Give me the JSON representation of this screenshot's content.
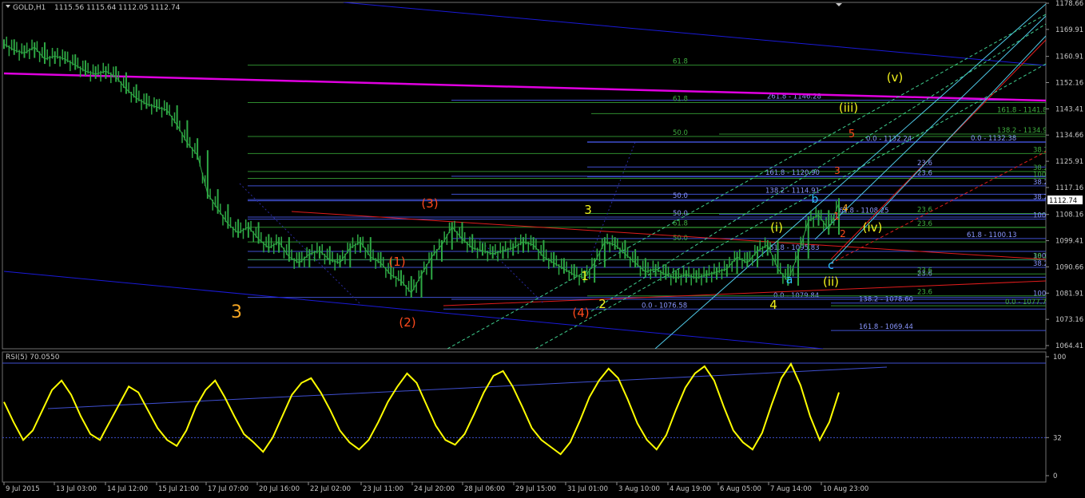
{
  "header": {
    "symbol": "GOLD,H1",
    "ohlc": "1115.56 1115.64 1112.05 1112.74",
    "current_price": "1112.74",
    "rsi_label": "RSI(5) 70.0550"
  },
  "colors": {
    "background": "#000000",
    "candles": "#2ea844",
    "rsi_line": "#ffff00",
    "fib_green": "#2e8b2e",
    "fib_blue": "#3f4fd0",
    "channel_blue": "#1a1ad8",
    "magenta_line": "#e000e0",
    "red_line": "#e01c1c",
    "cyan_line": "#4fc9e8",
    "wave_orange": "#f5a623",
    "wave_red": "#ff4a1c",
    "wave_yellow": "#f2f21c",
    "wave_cyan": "#2ec5ff"
  },
  "chart_data": [
    {
      "type": "line",
      "name": "price",
      "ylim": [
        1064.41,
        1178.66
      ],
      "y_ticks": [
        "1178.66",
        "1169.91",
        "1160.91",
        "1152.16",
        "1143.41",
        "1134.66",
        "1125.91",
        "1117.16",
        "1108.16",
        "1099.41",
        "1090.66",
        "1081.91",
        "1073.16",
        "1064.41"
      ],
      "x_ticks": [
        "9 Jul 2015",
        "13 Jul 03:00",
        "14 Jul 12:00",
        "15 Jul 21:00",
        "17 Jul 07:00",
        "20 Jul 16:00",
        "22 Jul 02:00",
        "23 Jul 11:00",
        "24 Jul 20:00",
        "28 Jul 06:00",
        "29 Jul 15:00",
        "31 Jul 01:00",
        "3 Aug 10:00",
        "4 Aug 19:00",
        "6 Aug 05:00",
        "7 Aug 14:00",
        "10 Aug 23:00"
      ],
      "approx_closes": [
        1165,
        1163,
        1162,
        1164,
        1160,
        1161,
        1160,
        1158,
        1156,
        1155,
        1156,
        1154,
        1150,
        1147,
        1145,
        1144,
        1143,
        1138,
        1132,
        1128,
        1115,
        1110,
        1105,
        1102,
        1104,
        1100,
        1097,
        1099,
        1094,
        1092,
        1095,
        1096,
        1093,
        1092,
        1097,
        1099,
        1094,
        1092,
        1088,
        1086,
        1082,
        1088,
        1094,
        1098,
        1104,
        1100,
        1097,
        1096,
        1095,
        1096,
        1097,
        1099,
        1098,
        1094,
        1092,
        1090,
        1088,
        1087,
        1092,
        1099,
        1098,
        1095,
        1092,
        1089,
        1090,
        1088,
        1087,
        1088,
        1087,
        1088,
        1089,
        1090,
        1094,
        1092,
        1096,
        1098,
        1090,
        1086,
        1095,
        1106,
        1108,
        1103,
        1112
      ],
      "wave_labels": [
        {
          "text": "3",
          "price": 1078.5
        },
        {
          "text": "(1)",
          "price": 1091.5
        },
        {
          "text": "(2)",
          "price": 1074.5
        },
        {
          "text": "(3)",
          "price": 1108.5
        },
        {
          "text": "(4)",
          "price": 1076.5
        },
        {
          "text": "1",
          "price": 1088.5
        },
        {
          "text": "2",
          "price": 1079.5
        },
        {
          "text": "3",
          "price": 1107.5
        },
        {
          "text": "4",
          "price": 1080.5
        },
        {
          "text": "(i)",
          "price": 1101.5
        },
        {
          "text": "(ii)",
          "price": 1087.5
        },
        {
          "text": "a",
          "price": 1088.5
        },
        {
          "text": "b",
          "price": 1110.5
        },
        {
          "text": "c",
          "price": 1093.5
        },
        {
          "text": "(iii)",
          "price": 1141.5
        },
        {
          "text": "(iv)",
          "price": 1102.5
        },
        {
          "text": "(v)",
          "price": 1153.5
        },
        {
          "text": "1",
          "price": 1107.5
        },
        {
          "text": "2",
          "price": 1095.5
        },
        {
          "text": "3",
          "price": 1120.5
        },
        {
          "text": "4",
          "price": 1108.5
        },
        {
          "text": "5",
          "price": 1134.5
        }
      ],
      "fib_levels": [
        {
          "label": "261.8 - 1146.28",
          "price": 1146.28,
          "color": "blue"
        },
        {
          "label": "61.8",
          "price": 1145.5,
          "color": "green"
        },
        {
          "label": "161.8 - 1141.82",
          "price": 1141.82,
          "color": "green"
        },
        {
          "label": "50.0",
          "price": 1134.2,
          "color": "green"
        },
        {
          "label": "0.0 - 1132.24",
          "price": 1132.24,
          "color": "blue"
        },
        {
          "label": "0.0 - 1132.38",
          "price": 1132.38,
          "color": "blue"
        },
        {
          "label": "138.2 - 1134.99",
          "price": 1134.99,
          "color": "green"
        },
        {
          "label": "38.2",
          "price": 1128.5,
          "color": "green"
        },
        {
          "label": "23.6",
          "price": 1124.0,
          "color": "blue"
        },
        {
          "label": "38.2",
          "price": 1122.5,
          "color": "green"
        },
        {
          "label": "161.8 - 1120.90",
          "price": 1120.9,
          "color": "blue"
        },
        {
          "label": "23.6",
          "price": 1120.7,
          "color": "blue"
        },
        {
          "label": "100.0",
          "price": 1120.2,
          "color": "green"
        },
        {
          "label": "38.2",
          "price": 1117.7,
          "color": "blue"
        },
        {
          "label": "138.2 - 1114.91",
          "price": 1114.91,
          "color": "blue"
        },
        {
          "label": "50.0",
          "price": 1113.1,
          "color": "blue"
        },
        {
          "label": "38.2",
          "price": 1112.7,
          "color": "blue"
        },
        {
          "label": "61.8 - 1108.25",
          "price": 1108.25,
          "color": "blue"
        },
        {
          "label": "23.6",
          "price": 1108.5,
          "color": "green"
        },
        {
          "label": "50.0",
          "price": 1107.3,
          "color": "blue"
        },
        {
          "label": "100.0",
          "price": 1106.6,
          "color": "blue"
        },
        {
          "label": "23.6",
          "price": 1103.8,
          "color": "green"
        },
        {
          "label": "61.8",
          "price": 1103.9,
          "color": "green"
        },
        {
          "label": "61.8 - 1100.13",
          "price": 1100.13,
          "color": "blue"
        },
        {
          "label": "50.0",
          "price": 1099.0,
          "color": "green"
        },
        {
          "label": "61.8 - 1095.83",
          "price": 1095.83,
          "color": "blue"
        },
        {
          "label": "100.0",
          "price": 1093.0,
          "color": "blue"
        },
        {
          "label": "38.2",
          "price": 1093.1,
          "color": "green"
        },
        {
          "label": "38.2",
          "price": 1090.5,
          "color": "blue"
        },
        {
          "label": "23.6",
          "price": 1087.2,
          "color": "blue"
        },
        {
          "label": "23.6",
          "price": 1088.3,
          "color": "green"
        },
        {
          "label": "0.0 - 1079.84",
          "price": 1079.84,
          "color": "blue"
        },
        {
          "label": "138.2 - 1078.60",
          "price": 1078.6,
          "color": "blue"
        },
        {
          "label": "100.0",
          "price": 1080.5,
          "color": "blue"
        },
        {
          "label": "0.0 - 1076.58",
          "price": 1076.58,
          "color": "blue"
        },
        {
          "label": "0.0 - 1077.70",
          "price": 1077.7,
          "color": "green"
        },
        {
          "label": "23.6",
          "price": 1081.0,
          "color": "green"
        },
        {
          "label": "61.8",
          "price": 1158.0,
          "color": "green"
        },
        {
          "label": "161.8 - 1069.44",
          "price": 1069.44,
          "color": "blue"
        }
      ]
    },
    {
      "type": "line",
      "name": "RSI(5)",
      "ylim": [
        0,
        100
      ],
      "y_ticks": [
        "100",
        "32",
        "0"
      ],
      "levels": [
        32
      ],
      "approx_values": [
        62,
        45,
        30,
        38,
        55,
        72,
        80,
        68,
        50,
        35,
        30,
        45,
        60,
        75,
        70,
        55,
        40,
        30,
        25,
        38,
        58,
        72,
        80,
        66,
        50,
        35,
        28,
        20,
        32,
        50,
        68,
        78,
        82,
        70,
        55,
        38,
        28,
        22,
        30,
        45,
        62,
        75,
        86,
        78,
        60,
        42,
        30,
        26,
        35,
        52,
        70,
        84,
        88,
        75,
        58,
        40,
        30,
        24,
        18,
        28,
        46,
        66,
        80,
        90,
        82,
        64,
        44,
        30,
        22,
        34,
        55,
        74,
        86,
        92,
        80,
        58,
        38,
        28,
        22,
        36,
        60,
        82,
        94,
        76,
        50,
        30,
        45,
        70
      ]
    }
  ]
}
